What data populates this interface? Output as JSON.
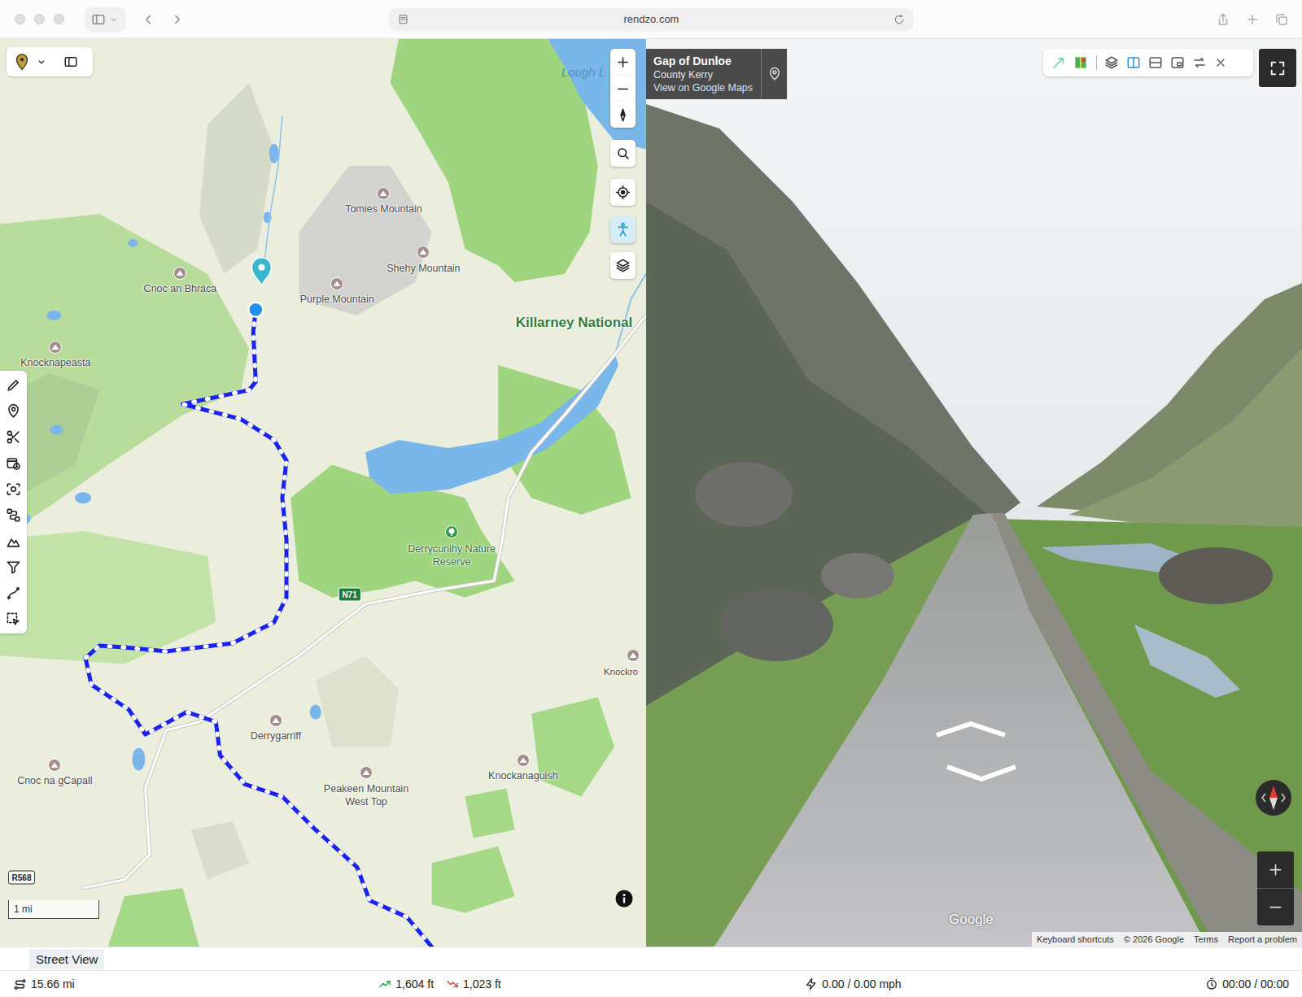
{
  "browser": {
    "url": "rendzo.com"
  },
  "map": {
    "labels": [
      {
        "text": "Lough L",
        "kind": "water"
      },
      {
        "text": "Tomies Mountain",
        "kind": "peak"
      },
      {
        "text": "Shehy Mountain",
        "kind": "peak"
      },
      {
        "text": "Purple Mountain",
        "kind": "peak"
      },
      {
        "text": "Cnoc an Bhráca",
        "kind": "peak"
      },
      {
        "text": "Knocknapeasta",
        "kind": "peak"
      },
      {
        "text": "Killarney National",
        "kind": "park"
      },
      {
        "text": "Derrycunihy Nature Reserve",
        "kind": "reserve"
      },
      {
        "text": "N71",
        "kind": "road"
      },
      {
        "text": "Knockro",
        "kind": "peak"
      },
      {
        "text": "Derrygarriff",
        "kind": "peak"
      },
      {
        "text": "Peakeen Mountain West Top",
        "kind": "peak"
      },
      {
        "text": "Knockanaguish",
        "kind": "peak"
      },
      {
        "text": "Cnoc na gCapall",
        "kind": "peak"
      },
      {
        "text": "R568",
        "kind": "road"
      }
    ],
    "scale": "1 mi",
    "street_view_toggle": {
      "selected": true
    }
  },
  "street_view": {
    "place": "Gap of Dunloe",
    "region": "County Kerry",
    "link": "View on Google Maps",
    "logo": "Google",
    "attribution": [
      "Keyboard shortcuts",
      "© 2026 Google",
      "Terms",
      "Report a problem"
    ]
  },
  "panel_tab": {
    "label": "Street View",
    "selected": true
  },
  "status_bar": {
    "distance": "15.66 mi",
    "ascent": "1,604 ft",
    "descent": "1,023 ft",
    "speed": "0.00 / 0.00 mph",
    "time": "00:00 / 00:00"
  }
}
